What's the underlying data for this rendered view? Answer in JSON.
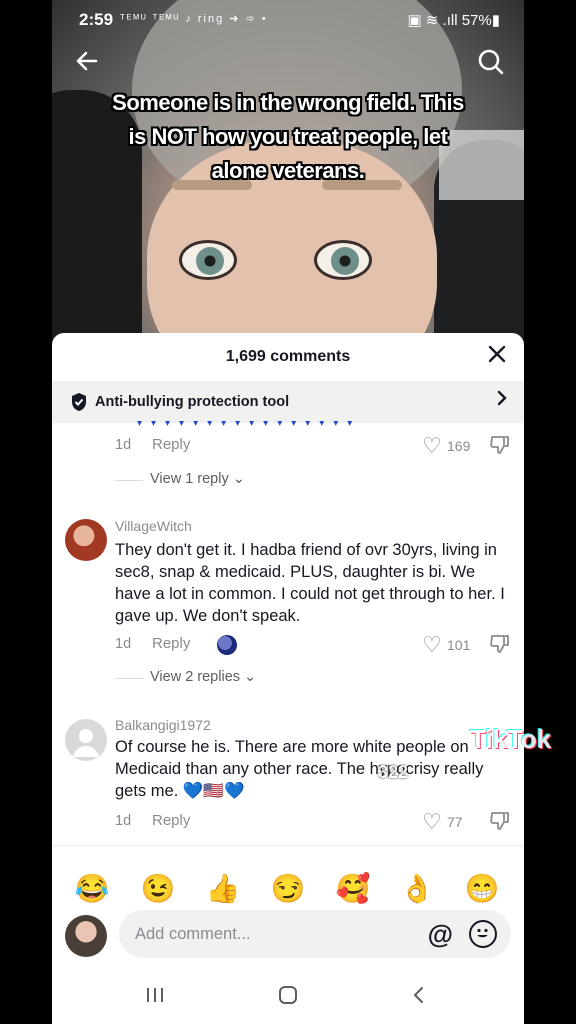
{
  "status_bar": {
    "time": "2:59",
    "left_icons": "ᵀᴱᴹᵁ ᵀᴱᴹᵁ ♪ ring ➜ ➾ •",
    "right_icons": "▣ ≋ .ıll 57%▮"
  },
  "video": {
    "overlay_text": "Someone is in the wrong field.  This is NOT how you treat people, let alone veterans."
  },
  "comments": {
    "count_label": "1,699 comments",
    "anti_bullying_label": "Anti-bullying protection tool",
    "items": [
      {
        "age": "1d",
        "reply_label": "Reply",
        "likes": "169",
        "view_replies": "View 1 reply"
      },
      {
        "username": "VillageWitch",
        "text": "They don't get it. I hadba friend of ovr 30yrs, living in sec8, snap & medicaid. PLUS, daughter is bi. We have a lot in common. I could not get through to her. I gave up. We don't speak.",
        "age": "1d",
        "reply_label": "Reply",
        "likes": "101",
        "view_replies": "View 2 replies"
      },
      {
        "username": "Balkangigi1972",
        "text": "Of course he is. There are more white people on Medicaid than any other race. The hypocrisy really gets me. 💙🇺🇸💙",
        "age": "1d",
        "reply_label": "Reply",
        "likes": "77"
      }
    ]
  },
  "emoji_bar": [
    "😂",
    "😉",
    "👍",
    "😏",
    "🥰",
    "👌",
    "😁"
  ],
  "composer": {
    "placeholder": "Add comment...",
    "mention_symbol": "@"
  },
  "watermark": {
    "logo": "TikTok",
    "handle": "322"
  },
  "colors": {
    "text_primary": "#161823",
    "text_secondary": "#8a8b91",
    "sheet_bg": "#ffffff",
    "bar_bg": "#f1f1f2"
  }
}
